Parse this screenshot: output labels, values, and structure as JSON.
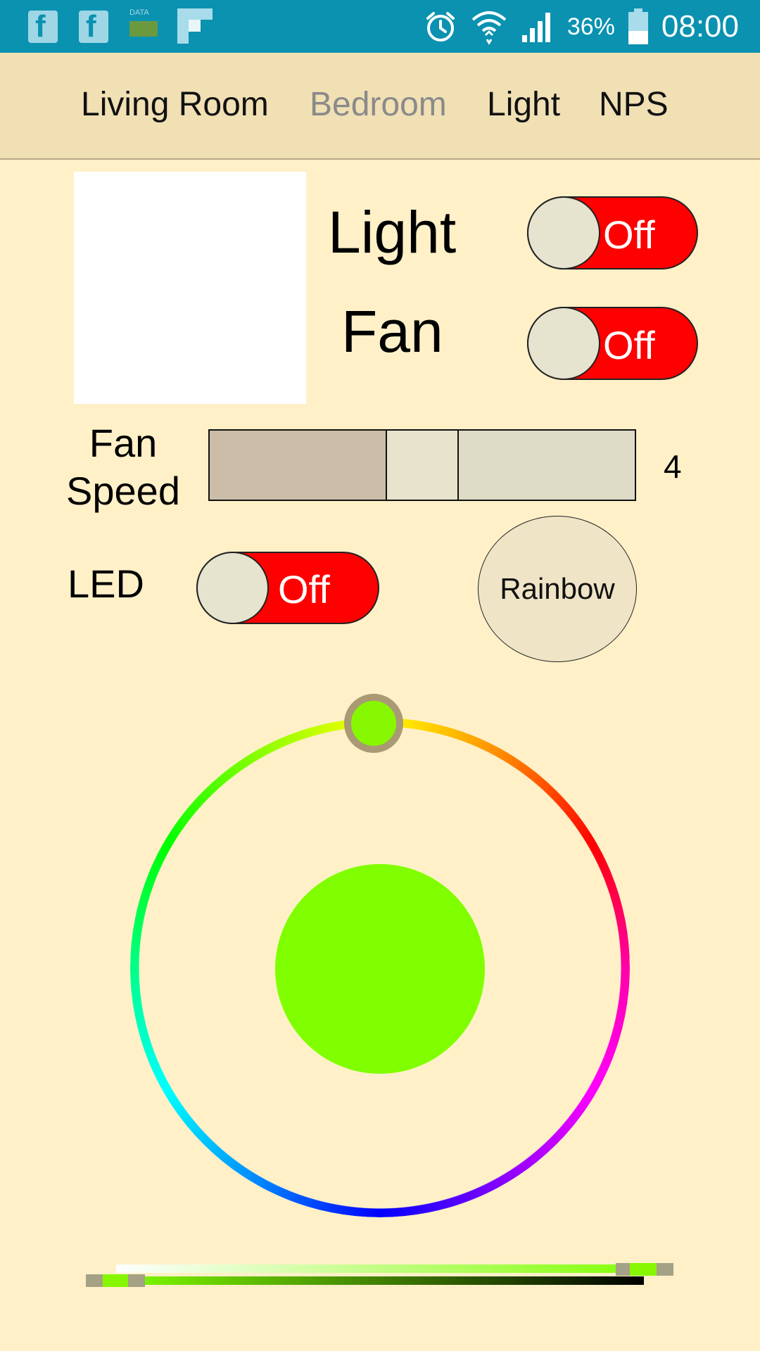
{
  "status_bar": {
    "left_icons": [
      "facebook-icon",
      "facebook-icon",
      "data-saver-icon",
      "flipboard-icon"
    ],
    "data_label": "DATA",
    "right_icons": [
      "alarm-icon",
      "wifi-icon",
      "cell-signal-icon",
      "battery-icon"
    ],
    "battery": "36%",
    "time": "08:00",
    "bg_color": "#0A92B0"
  },
  "tabs": [
    {
      "label": "Living Room",
      "active": false
    },
    {
      "label": "Bedroom",
      "active": true
    },
    {
      "label": "Light",
      "active": false
    },
    {
      "label": "NPS",
      "active": false
    }
  ],
  "controls": {
    "light": {
      "label": "Light",
      "state": "Off"
    },
    "fan": {
      "label": "Fan",
      "state": "Off"
    },
    "fan_speed": {
      "label_line1": "Fan",
      "label_line2": "Speed",
      "value": "4"
    },
    "led": {
      "label": "LED",
      "state": "Off"
    },
    "rainbow_button": "Rainbow"
  },
  "color_picker": {
    "selected_color": "#80FF00",
    "hue_handle_color": "#86F700",
    "saturation_level": 0.93,
    "value_level": 0.0
  },
  "colors": {
    "background": "#FFF0C8",
    "tab_bar": "#F0E0B4",
    "toggle_off": "#FF0000",
    "inactive_tab_text": "#8A8A8A"
  }
}
